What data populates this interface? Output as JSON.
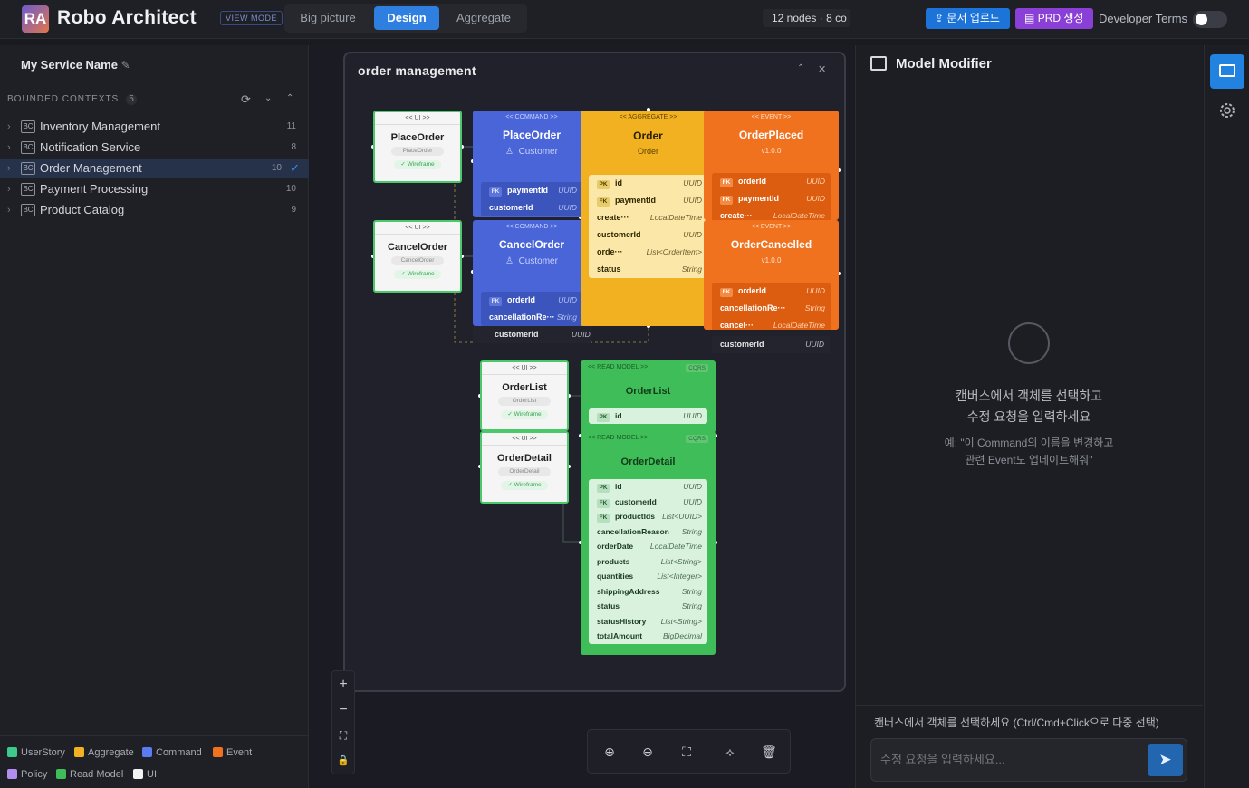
{
  "header": {
    "logo": "RA",
    "title": "Robo Architect",
    "view_mode": "VIEW MODE",
    "tabs": [
      "Big picture",
      "Design",
      "Aggregate"
    ],
    "active_tab": "Design",
    "nodes_count": "12 nodes",
    "connections": "8 co",
    "upload_btn": "문서 업로드",
    "prd_btn": "PRD 생성",
    "dev_terms": "Developer Terms",
    "dev_terms_on": false
  },
  "sidebar": {
    "service_name": "My Service Name",
    "bc_header": "BOUNDED CONTEXTS",
    "bc_count": "5",
    "contexts": [
      {
        "name": "Inventory Management",
        "count": "11",
        "selected": false
      },
      {
        "name": "Notification Service",
        "count": "8",
        "selected": false
      },
      {
        "name": "Order Management",
        "count": "10",
        "selected": true
      },
      {
        "name": "Payment Processing",
        "count": "10",
        "selected": false
      },
      {
        "name": "Product Catalog",
        "count": "9",
        "selected": false
      }
    ],
    "bc_badge": "BC",
    "legend": [
      {
        "label": "UserStory",
        "color": "#3ec98a"
      },
      {
        "label": "Aggregate",
        "color": "#f1b120"
      },
      {
        "label": "Command",
        "color": "#5b7cf0"
      },
      {
        "label": "Event",
        "color": "#f0711e"
      },
      {
        "label": "Policy",
        "color": "#b18ef0"
      },
      {
        "label": "Read Model",
        "color": "#3fbd58"
      },
      {
        "label": "UI",
        "color": "#f2f2f2"
      }
    ]
  },
  "canvas": {
    "frame_title": "order management",
    "ui_nodes": [
      {
        "stereo": "<< UI >>",
        "name": "PlaceOrder",
        "ref": "PlaceOrder",
        "wire": "✓ Wireframe"
      },
      {
        "stereo": "<< UI >>",
        "name": "CancelOrder",
        "ref": "CancelOrder",
        "wire": "✓ Wireframe"
      },
      {
        "stereo": "<< UI >>",
        "name": "OrderList",
        "ref": "OrderList",
        "wire": "✓ Wireframe"
      },
      {
        "stereo": "<< UI >>",
        "name": "OrderDetail",
        "ref": "OrderDetail",
        "wire": "✓ Wireframe"
      }
    ],
    "commands": [
      {
        "stereo": "<< COMMAND >>",
        "name": "PlaceOrder",
        "actor": "Customer",
        "props": [
          {
            "k": "FK",
            "n": "paymentId",
            "t": "UUID"
          },
          {
            "k": "",
            "n": "customerId",
            "t": "UUID"
          }
        ]
      },
      {
        "stereo": "<< COMMAND >>",
        "name": "CancelOrder",
        "actor": "Customer",
        "props": [
          {
            "k": "FK",
            "n": "orderId",
            "t": "UUID"
          },
          {
            "k": "",
            "n": "cancellationRe···",
            "t": "String"
          },
          {
            "k": "",
            "n": "customerId",
            "t": "UUID"
          }
        ]
      }
    ],
    "aggregate": {
      "stereo": "<< AGGREGATE >>",
      "name": "Order",
      "sub": "Order",
      "props": [
        {
          "k": "PK",
          "n": "id",
          "t": "UUID"
        },
        {
          "k": "FK",
          "n": "paymentId",
          "t": "UUID"
        },
        {
          "k": "",
          "n": "create···",
          "t": "LocalDateTime"
        },
        {
          "k": "",
          "n": "customerId",
          "t": "UUID"
        },
        {
          "k": "",
          "n": "orde···",
          "t": "List<OrderItem>"
        },
        {
          "k": "",
          "n": "status",
          "t": "String"
        }
      ]
    },
    "events": [
      {
        "stereo": "<< EVENT >>",
        "name": "OrderPlaced",
        "ver": "v1.0.0",
        "props": [
          {
            "k": "FK",
            "n": "orderId",
            "t": "UUID"
          },
          {
            "k": "FK",
            "n": "paymentId",
            "t": "UUID"
          },
          {
            "k": "",
            "n": "create···",
            "t": "LocalDateTime"
          }
        ]
      },
      {
        "stereo": "<< EVENT >>",
        "name": "OrderCancelled",
        "ver": "v1.0.0",
        "props": [
          {
            "k": "FK",
            "n": "orderId",
            "t": "UUID"
          },
          {
            "k": "",
            "n": "cancellationRe···",
            "t": "String"
          },
          {
            "k": "",
            "n": "cancel···",
            "t": "LocalDateTime"
          },
          {
            "k": "",
            "n": "customerId",
            "t": "UUID"
          }
        ]
      }
    ],
    "read_models": [
      {
        "stereo": "<< READ MODEL >>",
        "badge": "CQRS",
        "name": "OrderList",
        "props": [
          {
            "k": "PK",
            "n": "id",
            "t": "UUID"
          }
        ]
      },
      {
        "stereo": "<< READ MODEL >>",
        "badge": "CQRS",
        "name": "OrderDetail",
        "props": [
          {
            "k": "PK",
            "n": "id",
            "t": "UUID"
          },
          {
            "k": "FK",
            "n": "customerId",
            "t": "UUID"
          },
          {
            "k": "FK",
            "n": "productIds",
            "t": "List<UUID>"
          },
          {
            "k": "",
            "n": "cancellationReason",
            "t": "String"
          },
          {
            "k": "",
            "n": "orderDate",
            "t": "LocalDateTime"
          },
          {
            "k": "",
            "n": "products",
            "t": "List<String>"
          },
          {
            "k": "",
            "n": "quantities",
            "t": "List<Integer>"
          },
          {
            "k": "",
            "n": "shippingAddress",
            "t": "String"
          },
          {
            "k": "",
            "n": "status",
            "t": "String"
          },
          {
            "k": "",
            "n": "statusHistory",
            "t": "List<String>"
          },
          {
            "k": "",
            "n": "totalAmount",
            "t": "BigDecimal"
          }
        ]
      }
    ]
  },
  "right_panel": {
    "title": "Model Modifier",
    "empty_line1": "캔버스에서 객체를 선택하고",
    "empty_line2": "수정 요청을 입력하세요",
    "example_line1": "예: \"이 Command의 이름을 변경하고",
    "example_line2": "관련 Event도 업데이트해줘\"",
    "hint": "캔버스에서 객체를 선택하세요 (Ctrl/Cmd+Click으로 다중 선택)",
    "input_placeholder": "수정 요청을 입력하세요..."
  }
}
